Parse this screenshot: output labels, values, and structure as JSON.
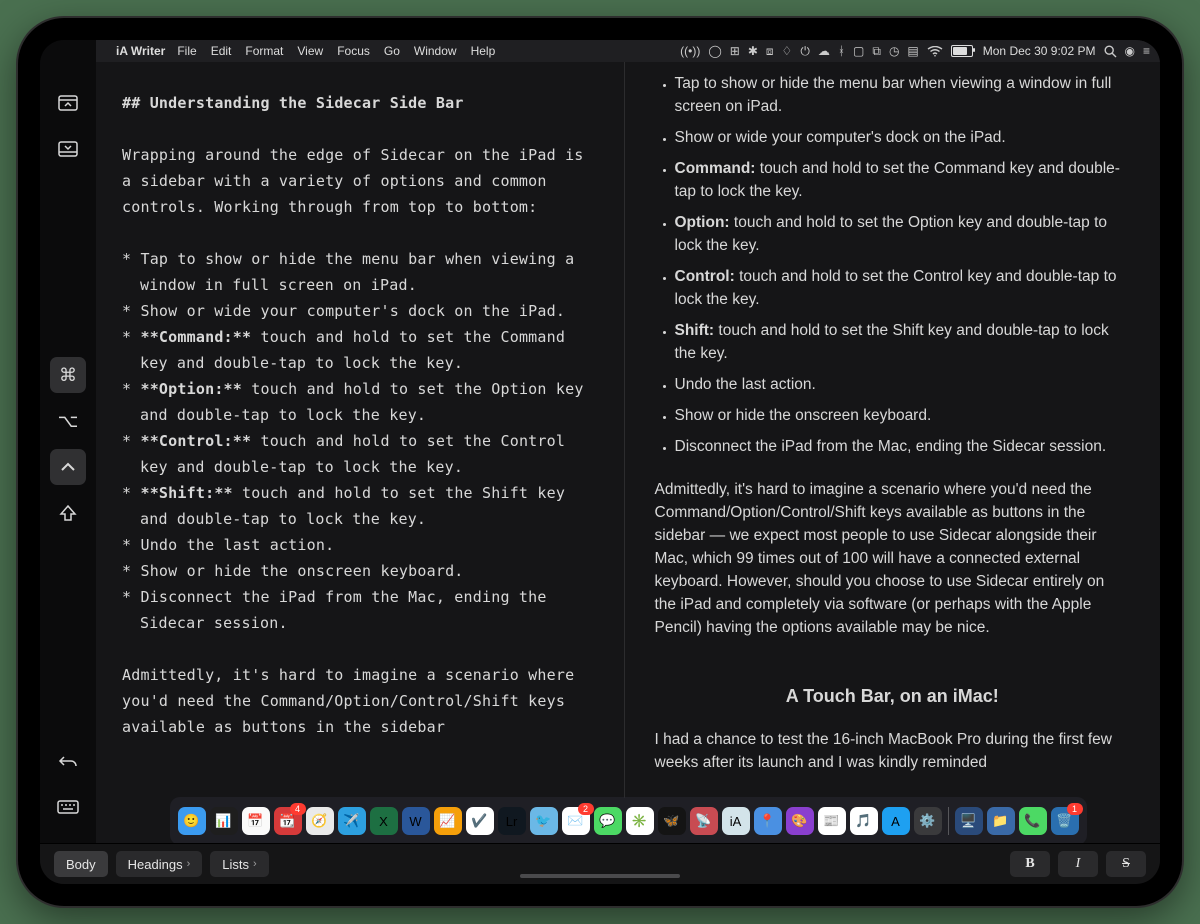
{
  "menubar": {
    "app_name": "iA Writer",
    "items": [
      "File",
      "Edit",
      "Format",
      "View",
      "Focus",
      "Go",
      "Window",
      "Help"
    ],
    "clock": "Mon Dec 30  9:02 PM"
  },
  "sidecar_sidebar": {
    "buttons": [
      {
        "name": "menubar-toggle",
        "glyph": "menubar"
      },
      {
        "name": "dock-toggle",
        "glyph": "dock"
      },
      {
        "name": "command-key",
        "glyph": "⌘",
        "active": true
      },
      {
        "name": "option-key",
        "glyph": "⌥"
      },
      {
        "name": "control-key",
        "glyph": "ctrl",
        "active": true
      },
      {
        "name": "shift-key",
        "glyph": "⇧"
      },
      {
        "name": "undo",
        "glyph": "↶"
      },
      {
        "name": "keyboard-toggle",
        "glyph": "keyboard"
      },
      {
        "name": "disconnect",
        "glyph": "disconnect"
      }
    ]
  },
  "editor": {
    "heading_prefix": "## ",
    "heading_text": "Understanding the Sidecar Side Bar",
    "intro": "Wrapping around the edge of Sidecar on the iPad is a sidebar with a variety of options and common controls. Working through from top to bottom:",
    "bullets": [
      {
        "prefix": "* ",
        "body": "Tap to show or hide the menu bar when viewing a window in full screen on iPad."
      },
      {
        "prefix": "* ",
        "body": "Show or wide your computer's dock on the iPad."
      },
      {
        "prefix": "* ",
        "strong": "**Command:**",
        "body": " touch and hold to set the Command key and double-tap to lock the key."
      },
      {
        "prefix": "* ",
        "strong": "**Option:**",
        "body": " touch and hold to set the Option key and double-tap to lock the key."
      },
      {
        "prefix": "* ",
        "strong": "**Control:**",
        "body": " touch and hold to set the Control key and double-tap to lock the key."
      },
      {
        "prefix": "* ",
        "strong": "**Shift:**",
        "body": " touch and hold to set the Shift key and double-tap to lock the key."
      },
      {
        "prefix": "* ",
        "body": "Undo the last action."
      },
      {
        "prefix": "* ",
        "body": "Show or hide the onscreen keyboard."
      },
      {
        "prefix": "* ",
        "body": "Disconnect the iPad from the Mac, ending the Sidecar session."
      }
    ],
    "outro": "Admittedly, it's hard to imagine a scenario where you'd need the Command/Option/Control/Shift keys available as buttons in the sidebar"
  },
  "preview": {
    "bullets": [
      {
        "body": "Tap to show or hide the menu bar when viewing a window in full screen on iPad."
      },
      {
        "body": "Show or wide your computer's dock on the iPad."
      },
      {
        "strong": "Command:",
        "body": " touch and hold to set the Command key and double-tap to lock the key."
      },
      {
        "strong": "Option:",
        "body": " touch and hold to set the Option key and double-tap to lock the key."
      },
      {
        "strong": "Control:",
        "body": " touch and hold to set the Control key and double-tap to lock the key."
      },
      {
        "strong": "Shift:",
        "body": " touch and hold to set the Shift key and double-tap to lock the key."
      },
      {
        "body": "Undo the last action."
      },
      {
        "body": "Show or hide the onscreen keyboard."
      },
      {
        "body": "Disconnect the iPad from the Mac, ending the Sidecar session."
      }
    ],
    "para": "Admittedly, it's hard to imagine a scenario where you'd need the Command/Option/Control/Shift keys available as buttons in the sidebar — we expect most people to use Sidecar alongside their Mac, which 99 times out of 100 will have a connected external keyboard. However, should you choose to use Sidecar entirely on the iPad and completely via software (or perhaps with the Apple Pencil) having the options available may be nice.",
    "heading": "A Touch Bar, on an iMac!",
    "para2": "I had a chance to test the 16-inch MacBook Pro during the first few weeks after its launch and I was kindly reminded"
  },
  "dock": {
    "apps": [
      {
        "name": "finder",
        "bg": "#3b9bf1",
        "glyph": "🙂"
      },
      {
        "name": "activity",
        "bg": "#1e1e1e",
        "glyph": "📊"
      },
      {
        "name": "calendar",
        "bg": "#fafafa",
        "glyph": "📅"
      },
      {
        "name": "fantastical",
        "bg": "#d63a3a",
        "glyph": "📆",
        "badge": "4"
      },
      {
        "name": "safari",
        "bg": "#eaeaea",
        "glyph": "🧭"
      },
      {
        "name": "telegram",
        "bg": "#2da0e0",
        "glyph": "✈️"
      },
      {
        "name": "excel",
        "bg": "#1d6f42",
        "glyph": "X"
      },
      {
        "name": "word",
        "bg": "#2a579a",
        "glyph": "W"
      },
      {
        "name": "stocks",
        "bg": "#f59f0a",
        "glyph": "📈"
      },
      {
        "name": "things",
        "bg": "#fff",
        "glyph": "✔️"
      },
      {
        "name": "lightroom",
        "bg": "#101820",
        "glyph": "Lr"
      },
      {
        "name": "tweetbot",
        "bg": "#6bb8e6",
        "glyph": "🐦"
      },
      {
        "name": "mail",
        "bg": "#fff",
        "glyph": "✉️",
        "badge": "2"
      },
      {
        "name": "messages",
        "bg": "#4cd964",
        "glyph": "💬"
      },
      {
        "name": "slack",
        "bg": "#fff",
        "glyph": "✳️"
      },
      {
        "name": "butterfly",
        "bg": "#141414",
        "glyph": "🦋"
      },
      {
        "name": "radar",
        "bg": "#c84b52",
        "glyph": "📡"
      },
      {
        "name": "iawriter",
        "bg": "#d3e4ea",
        "glyph": "iA"
      },
      {
        "name": "maps",
        "bg": "#4a90e2",
        "glyph": "📍"
      },
      {
        "name": "pixelmator",
        "bg": "#8a3fcf",
        "glyph": "🎨"
      },
      {
        "name": "news",
        "bg": "#fff",
        "glyph": "📰"
      },
      {
        "name": "music",
        "bg": "#fff",
        "glyph": "🎵"
      },
      {
        "name": "appstore",
        "bg": "#1ea0f1",
        "glyph": "A"
      },
      {
        "name": "systemprefs",
        "bg": "#3a3a3c",
        "glyph": "⚙️"
      },
      {
        "name": "sep",
        "sep": true
      },
      {
        "name": "desktop",
        "bg": "#2a4a7a",
        "glyph": "🖥️"
      },
      {
        "name": "folder",
        "bg": "#3a6aa8",
        "glyph": "📁"
      },
      {
        "name": "facetime",
        "bg": "#4cd964",
        "glyph": "📞"
      },
      {
        "name": "trash",
        "bg": "#2a6fb0",
        "glyph": "🗑️",
        "badge": "1"
      }
    ]
  },
  "touchbar": {
    "body": "Body",
    "headings": "Headings",
    "lists": "Lists",
    "bold": "B",
    "italic": "I",
    "strike": "S"
  }
}
